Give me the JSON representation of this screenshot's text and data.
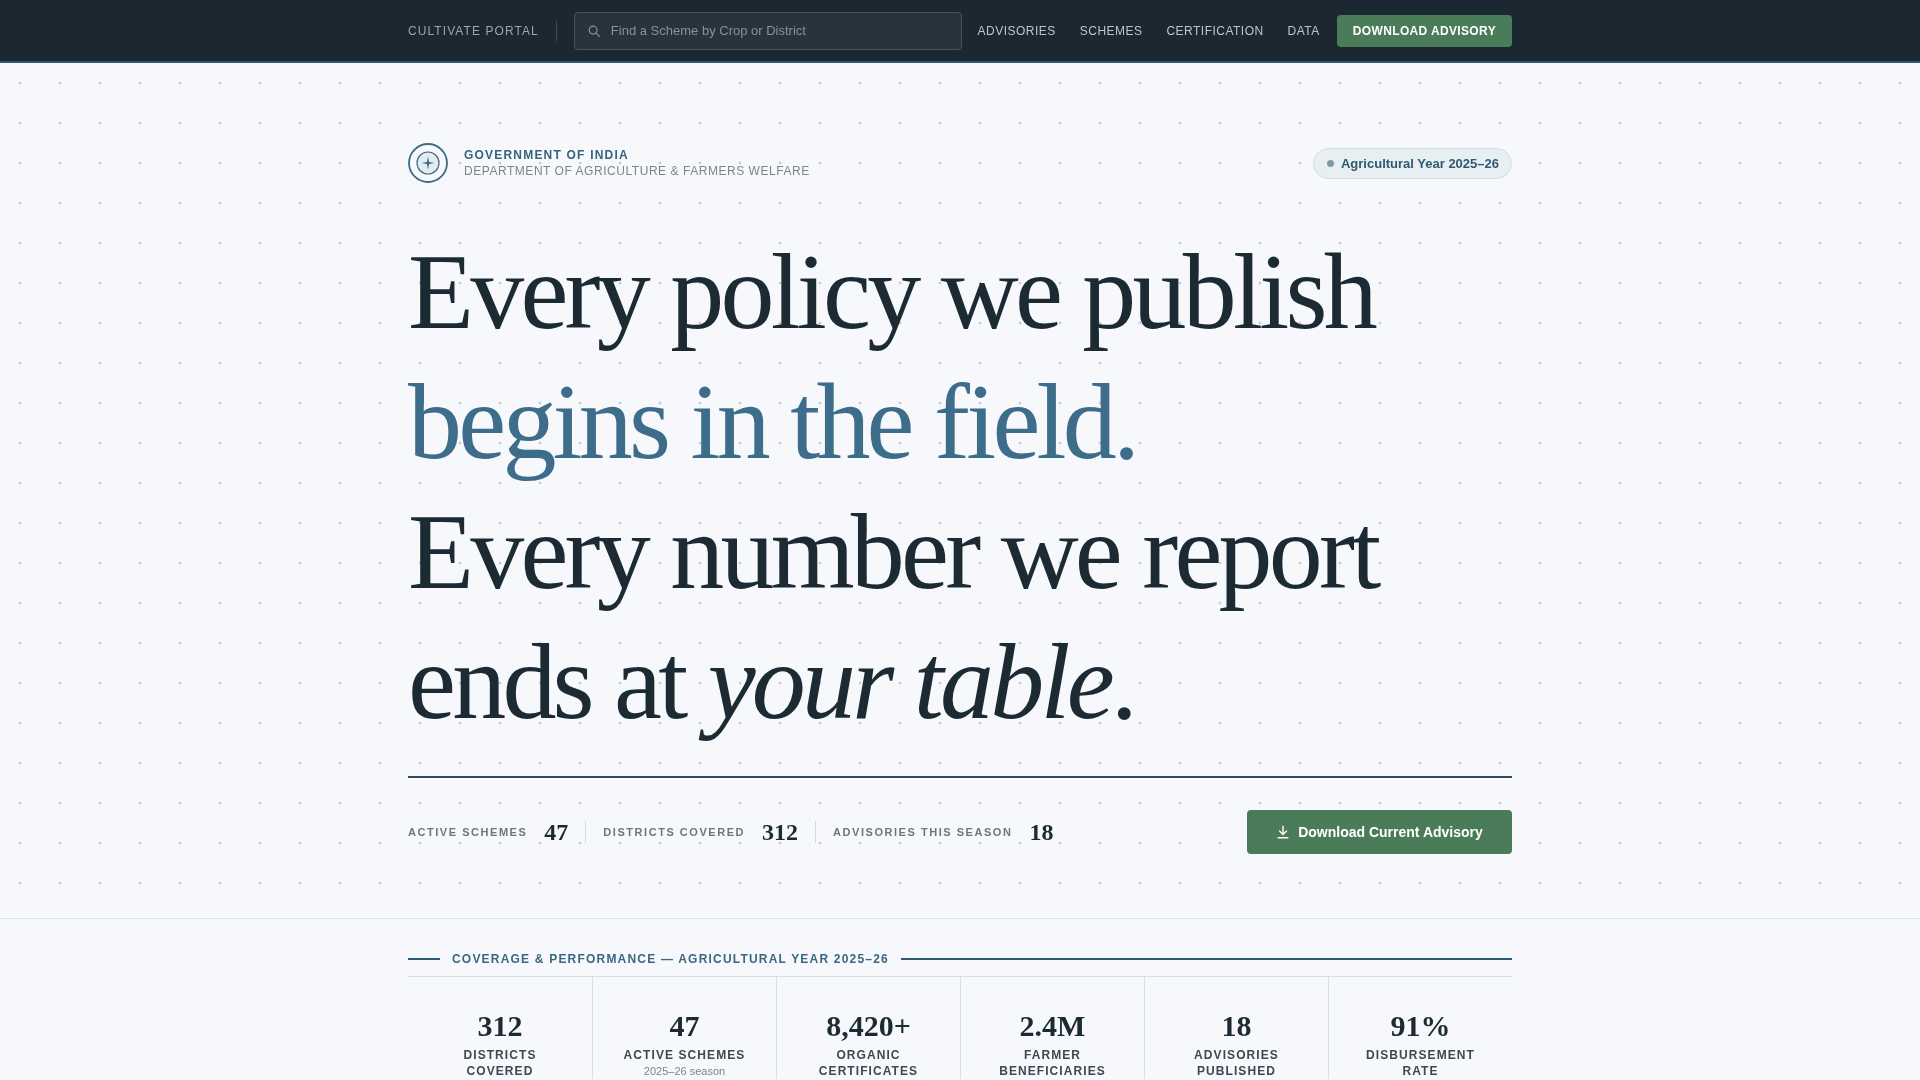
{
  "nav": {
    "brand": "CULTIVATE PORTAL",
    "search": {
      "placeholder": "Find a Scheme by Crop or District"
    },
    "links": [
      "ADVISORIES",
      "SCHEMES",
      "CERTIFICATION",
      "DATA"
    ],
    "button": "DOWNLOAD ADVISORY"
  },
  "masthead": {
    "title": "GOVERNMENT OF INDIA",
    "subtitle": "DEPARTMENT OF AGRICULTURE & FARMERS WELFARE",
    "badge": "Agricultural Year 2025–26"
  },
  "headline": [
    {
      "kind": "plain",
      "text": "Every policy we publish"
    },
    {
      "kind": "accent",
      "text": "begins in the field."
    },
    {
      "kind": "plain",
      "text": "Every number we report"
    },
    {
      "kind": "plain",
      "text": "ends at *your table*."
    }
  ],
  "stats": [
    {
      "label": "ACTIVE SCHEMES",
      "value": "47"
    },
    {
      "label": "DISTRICTS COVERED",
      "value": "312"
    },
    {
      "label": "ADVISORIES THIS SEASON",
      "value": "18"
    }
  ],
  "stats_button": "Download Current Advisory",
  "coverage": {
    "heading": "COVERAGE & PERFORMANCE — AGRICULTURAL YEAR 2025–26",
    "metrics": [
      {
        "value": "312",
        "label": "DISTRICTS COVERED"
      },
      {
        "value": "47",
        "label": "ACTIVE SCHEMES",
        "note": "2025–26 season"
      },
      {
        "value": "8,420+",
        "label": "ORGANIC CERTIFICATES"
      },
      {
        "value": "2.4M",
        "label": "FARMER BENEFICIARIES"
      },
      {
        "value": "18",
        "label": "ADVISORIES PUBLISHED"
      },
      {
        "value": "91%",
        "label": "DISBURSEMENT RATE"
      }
    ]
  }
}
